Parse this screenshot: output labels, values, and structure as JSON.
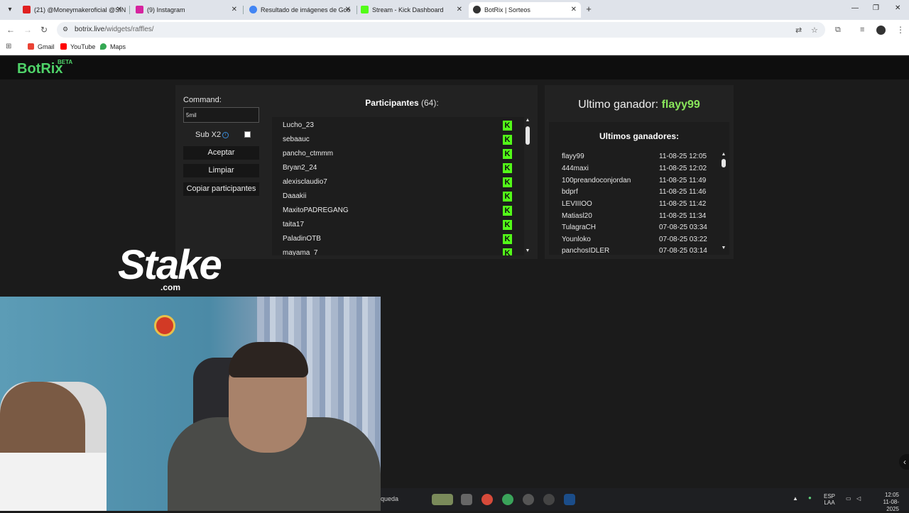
{
  "browser": {
    "tabs": [
      {
        "title": "(21) @Moneymakeroficial @SIN",
        "color": "#e02020"
      },
      {
        "title": "(9) Instagram",
        "color": "#d6249f"
      },
      {
        "title": "Resultado de imágenes de Goo",
        "color": "#4285f4"
      },
      {
        "title": "Stream - Kick Dashboard",
        "color": "#53fc18"
      },
      {
        "title": "BotRix | Sorteos",
        "color": "#333333"
      }
    ],
    "url_host": "botrix.live",
    "url_path": "/widgets/raffles/",
    "bookmarks": [
      {
        "label": "Gmail",
        "color": "#ea4335"
      },
      {
        "label": "YouTube",
        "color": "#ff0000"
      },
      {
        "label": "Maps",
        "color": "#34a853"
      }
    ]
  },
  "app": {
    "logo": "BotRix",
    "beta": "BETA"
  },
  "controls": {
    "command_label": "Command:",
    "command_value": "5mil",
    "subx2_label": "Sub X2",
    "accept_label": "Aceptar",
    "clear_label": "Limpiar",
    "copy_label": "Copiar participantes"
  },
  "participants": {
    "title": "Participantes",
    "count": "(64):",
    "list": [
      "Lucho_23",
      "sebaauc",
      "pancho_ctmmm",
      "Bryan2_24",
      "alexisclaudio7",
      "Daaakii",
      "MaxitoPADREGANG",
      "taita17",
      "PaladinOTB",
      "mayama_7"
    ]
  },
  "winner": {
    "label": "Ultimo ganador:",
    "name": "flayy99"
  },
  "last_winners": {
    "title": "Ultimos ganadores:",
    "rows": [
      {
        "name": "flayy99",
        "date": "11-08-25 12:05"
      },
      {
        "name": "444maxi",
        "date": "11-08-25 12:02"
      },
      {
        "name": "100preandoconjordan",
        "date": "11-08-25 11:49"
      },
      {
        "name": "bdprf",
        "date": "11-08-25 11:46"
      },
      {
        "name": "LEVIIIOO",
        "date": "11-08-25 11:42"
      },
      {
        "name": "Matiasl20",
        "date": "11-08-25 11:34"
      },
      {
        "name": "TulagraCH",
        "date": "07-08-25 03:34"
      },
      {
        "name": "Younloko",
        "date": "07-08-25 03:22"
      },
      {
        "name": "panchosIDLER",
        "date": "07-08-25 03:14"
      }
    ]
  },
  "overlay": {
    "stake": "Stake",
    "stake_com": ".com"
  },
  "taskbar": {
    "search_text": "queda",
    "lang_top": "ESP",
    "lang_bottom": "LAA",
    "time": "12:05",
    "date": "11-08-2025"
  }
}
